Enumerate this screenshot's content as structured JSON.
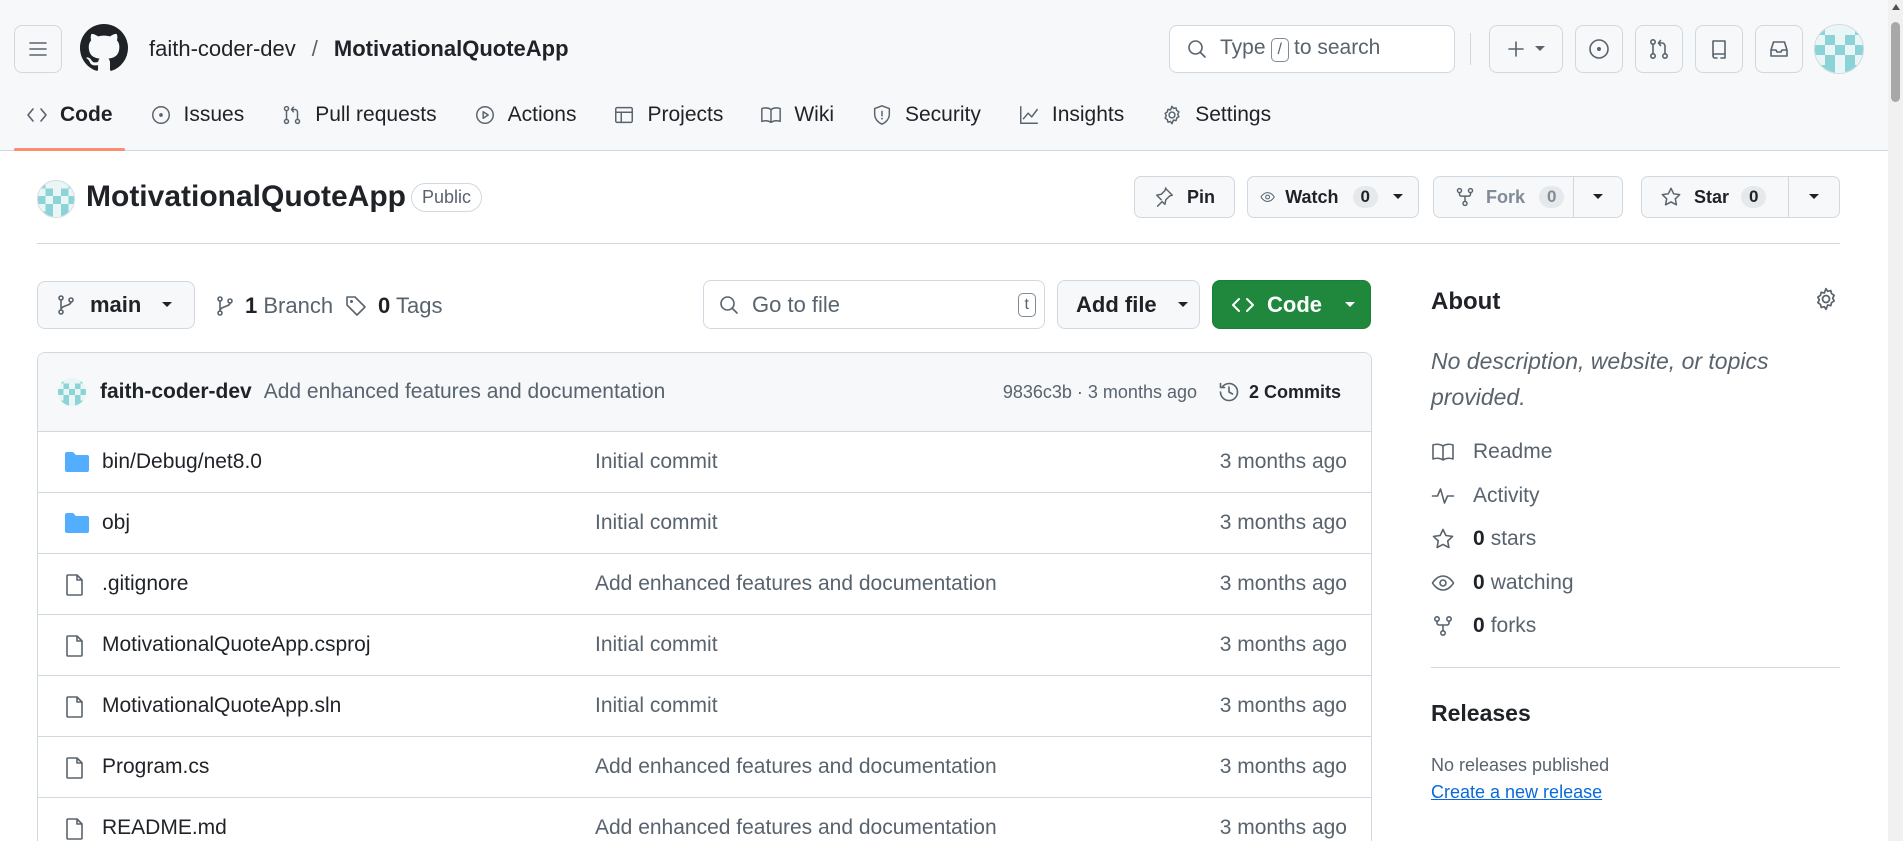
{
  "header": {
    "owner": "faith-coder-dev",
    "separator": "/",
    "repo": "MotivationalQuoteApp",
    "search_prefix": "Type",
    "search_key": "/",
    "search_suffix": "to search"
  },
  "tabs": [
    {
      "label": "Code",
      "icon": "code-icon"
    },
    {
      "label": "Issues",
      "icon": "issue-opened-icon"
    },
    {
      "label": "Pull requests",
      "icon": "git-pull-request-icon"
    },
    {
      "label": "Actions",
      "icon": "play-icon"
    },
    {
      "label": "Projects",
      "icon": "table-icon"
    },
    {
      "label": "Wiki",
      "icon": "book-icon"
    },
    {
      "label": "Security",
      "icon": "shield-icon"
    },
    {
      "label": "Insights",
      "icon": "graph-icon"
    },
    {
      "label": "Settings",
      "icon": "gear-icon"
    }
  ],
  "repo_header": {
    "title": "MotivationalQuoteApp",
    "visibility": "Public",
    "pin_label": "Pin",
    "watch_label": "Watch",
    "watch_count": "0",
    "fork_label": "Fork",
    "fork_count": "0",
    "star_label": "Star",
    "star_count": "0"
  },
  "controls": {
    "branch": "main",
    "branches_count": "1",
    "branches_label": "Branch",
    "tags_count": "0",
    "tags_label": "Tags",
    "goto_placeholder": "Go to file",
    "goto_key": "t",
    "add_file_label": "Add file",
    "code_label": "Code"
  },
  "latest_commit": {
    "author": "faith-coder-dev",
    "message": "Add enhanced features and documentation",
    "meta": "9836c3b · 3 months ago",
    "commits_label": "2 Commits"
  },
  "files": [
    {
      "name": "bin/Debug/net8.0",
      "type": "folder",
      "message": "Initial commit",
      "date": "3 months ago"
    },
    {
      "name": "obj",
      "type": "folder",
      "message": "Initial commit",
      "date": "3 months ago"
    },
    {
      "name": ".gitignore",
      "type": "file",
      "message": "Add enhanced features and documentation",
      "date": "3 months ago"
    },
    {
      "name": "MotivationalQuoteApp.csproj",
      "type": "file",
      "message": "Initial commit",
      "date": "3 months ago"
    },
    {
      "name": "MotivationalQuoteApp.sln",
      "type": "file",
      "message": "Initial commit",
      "date": "3 months ago"
    },
    {
      "name": "Program.cs",
      "type": "file",
      "message": "Add enhanced features and documentation",
      "date": "3 months ago"
    },
    {
      "name": "README.md",
      "type": "file",
      "message": "Add enhanced features and documentation",
      "date": "3 months ago"
    }
  ],
  "sidebar": {
    "about_title": "About",
    "description": "No description, website, or topics provided.",
    "readme": "Readme",
    "activity": "Activity",
    "stars_count": "0",
    "stars_label": "stars",
    "watching_count": "0",
    "watching_label": "watching",
    "forks_count": "0",
    "forks_label": "forks",
    "releases_title": "Releases",
    "no_releases": "No releases published",
    "create_release": "Create a new release"
  },
  "colors": {
    "accent_green": "#1f883d",
    "link_blue": "#0969da",
    "folder_blue": "#54aeff",
    "tab_underline": "#fd8c73"
  }
}
